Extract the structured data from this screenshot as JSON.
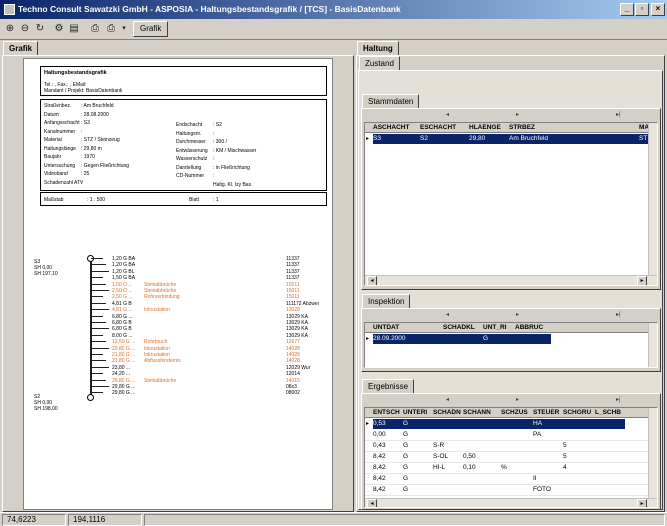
{
  "window": {
    "title": "Techno Consult Sawatzki GmbH - ASPOSIA - Haltungsbestandsgrafik / [TCS] - BasisDatenbank",
    "controls": [
      "_",
      "▫",
      "×"
    ]
  },
  "toolbar": {
    "grafik_button": "Grafik"
  },
  "left_tab": "Grafik",
  "doc": {
    "header_title": "Haltungsbestandsgrafik",
    "tel_line": "Tel.:    , Fax.:    , EMail:",
    "mandant_line": "Mandant / Projekt: BasisDatenbank",
    "fields_left": [
      [
        "Straßenbez.",
        ": Am Bruchfeld"
      ],
      [
        "Datum",
        ": 28.08.2000"
      ],
      [
        "Anfangsschacht",
        ": S3"
      ],
      [
        "Kanalnummer",
        ":"
      ],
      [
        "Material",
        ": STZ / Steinzeug"
      ],
      [
        "Haltungslänge",
        ": 29,80 m"
      ],
      [
        "Baujahr",
        ": 1970"
      ],
      [
        "Untersuchung",
        ": Gegen Fließrichtung"
      ],
      [
        "Videoband",
        ": 25"
      ],
      [
        "Schadenzahl ATV",
        ":"
      ]
    ],
    "fields_right": [
      [
        "Endschacht",
        ": S2"
      ],
      [
        "Haltungsnr.",
        ":"
      ],
      [
        "Durchmesser",
        ": 300 /"
      ],
      [
        "Entwässerung",
        ": KM / Mischwasser"
      ],
      [
        "Wasserschutz",
        ":"
      ],
      [
        "Darstellung",
        ": in Fließrichtung"
      ],
      [
        "CD-Nummer",
        ":"
      ],
      [
        "",
        "Haltg. Kl. Izy Bas"
      ]
    ],
    "massstab_label": "Maßstab",
    "massstab_value": ": 1 : 500",
    "blatt_label": "Blatt",
    "blatt_value": ": 1",
    "top_shaft": [
      "S3",
      "SH 0,00",
      "SH 197,10"
    ],
    "bottom_shaft": [
      "S2",
      "SH 0,00",
      "SH 198,00"
    ],
    "entries": [
      {
        "station": "1,20 G BA",
        "text": "",
        "code": "11337",
        "orange": false
      },
      {
        "station": "1,20 G BA",
        "text": "",
        "code": "11337",
        "orange": false
      },
      {
        "station": "1,20 G BL",
        "text": "",
        "code": "11337",
        "orange": false
      },
      {
        "station": "1,50 G BA",
        "text": "",
        "code": "11337",
        "orange": false
      },
      {
        "station": "1,50 O ...",
        "text": "Steinabbrüche",
        "code": "15011",
        "orange": true
      },
      {
        "station": "2,50 O ...",
        "text": "Steinabbrüche",
        "code": "15011",
        "orange": true
      },
      {
        "station": "2,50 G ...",
        "text": "Rohrverbindung",
        "code": "15011",
        "orange": true
      },
      {
        "station": "4,81 G B",
        "text": "",
        "code": "111172 Abzwei",
        "orange": false
      },
      {
        "station": "4,81 G ...",
        "text": "Inkrustation",
        "code": "13029",
        "orange": true
      },
      {
        "station": "6,80 G ...",
        "text": "",
        "code": "13029 KA",
        "orange": false
      },
      {
        "station": "6,80 G B",
        "text": "",
        "code": "13029 KA",
        "orange": false
      },
      {
        "station": "6,80 G B",
        "text": "",
        "code": "13029 KA",
        "orange": false
      },
      {
        "station": "8,00 G ...",
        "text": "",
        "code": "13029 KA",
        "orange": false
      },
      {
        "station": "13,50 G ...",
        "text": "Rohrbruch",
        "code": "12677",
        "orange": true
      },
      {
        "station": "20,80 G ...",
        "text": "Inkrustation",
        "code": "14028",
        "orange": true
      },
      {
        "station": "21,80 G ...",
        "text": "Inkrustation",
        "code": "14028",
        "orange": true
      },
      {
        "station": "21,80 G ...",
        "text": "Abflusshindernis",
        "code": "14028",
        "orange": true
      },
      {
        "station": "23,80 ...",
        "text": "",
        "code": "12029 Wur",
        "orange": false
      },
      {
        "station": "24,20 ...",
        "text": "",
        "code": "12014",
        "orange": false
      },
      {
        "station": "26,80 G ...",
        "text": "Steinabbrüche",
        "code": "14015",
        "orange": true
      },
      {
        "station": "29,80 G ...",
        "text": "",
        "code": "08x3",
        "orange": false
      },
      {
        "station": "29,80 G ...",
        "text": "",
        "code": "08002",
        "orange": false
      }
    ]
  },
  "right": {
    "tab_haltung": "Haltung",
    "tab_zustand": "Zustand",
    "stammdaten": {
      "tab": "Stammdaten",
      "columns": [
        "ASCHACHT",
        "ESCHACHT",
        "HLAENGE",
        "STRBEZ",
        "MA"
      ],
      "rows": [
        [
          "S3",
          "S2",
          "29,80",
          "Am Bruchfeld",
          "ST"
        ]
      ]
    },
    "inspektion": {
      "tab": "Inspektion",
      "columns": [
        "UNTDAT",
        "SCHADKL",
        "UNT_RI",
        "ABBRUC"
      ],
      "rows": [
        [
          "28.09.2000",
          "",
          "G",
          ""
        ]
      ]
    },
    "ergebnisse": {
      "tab": "Ergebnisse",
      "columns": [
        "ENTSCH",
        "UNTERI",
        "SCHADN",
        "SCHANN",
        "SCHZUS",
        "STEUER",
        "SCHGRU",
        "L_SCHB"
      ],
      "rows": [
        [
          "0,53",
          "G",
          "",
          "",
          "",
          "HA",
          "",
          ""
        ],
        [
          "0,00",
          "G",
          "",
          "",
          "",
          "PA",
          "",
          ""
        ],
        [
          "0,43",
          "G",
          "S-R",
          "",
          "",
          "",
          "5",
          ""
        ],
        [
          "8,42",
          "G",
          "S-OL",
          "0,50",
          "",
          "",
          "5",
          ""
        ],
        [
          "8,42",
          "G",
          "HI-L",
          "0,10",
          "%",
          "",
          "4",
          ""
        ],
        [
          "8,42",
          "G",
          "",
          "",
          "",
          "II",
          "",
          ""
        ],
        [
          "8,42",
          "G",
          "",
          "",
          "",
          "FOTO",
          "",
          ""
        ]
      ]
    }
  },
  "status": {
    "x": "74,6223",
    "y": "194,1116"
  },
  "colors": {
    "title_start": "#0a246a",
    "title_end": "#a6caf0",
    "selection": "#0a246a",
    "damage_text": "#e07020"
  }
}
